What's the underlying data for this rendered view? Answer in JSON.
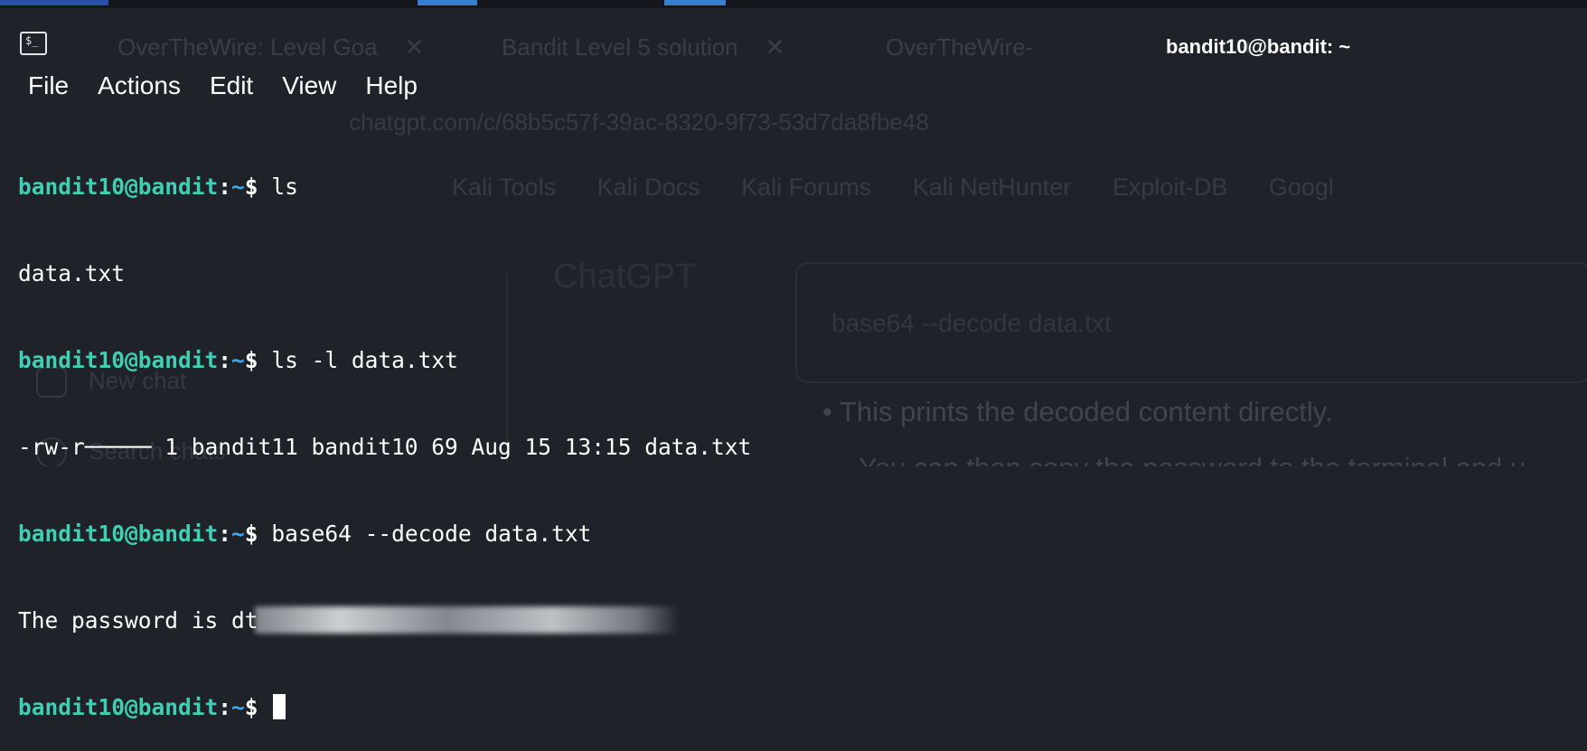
{
  "window": {
    "title": "bandit10@bandit: ~",
    "terminal_icon_glyph": "$_"
  },
  "menu": [
    "File",
    "Actions",
    "Edit",
    "View",
    "Help"
  ],
  "terminal": {
    "prompt_user": "bandit10@bandit",
    "prompt_colon": ":",
    "prompt_path": "~",
    "prompt_dollar": "$",
    "commands": [
      "ls",
      "ls -l data.txt",
      "base64 --decode data.txt"
    ],
    "outputs": [
      "data.txt",
      "-rw-r───── 1 bandit11 bandit10 69 Aug 15 13:15 data.txt",
      "The password is dt"
    ]
  },
  "background": {
    "tabs": [
      {
        "label": "OverTheWire: Level Goa",
        "close": "✕"
      },
      {
        "label": "Bandit Level 5 solution",
        "close": "✕"
      },
      {
        "label": "OverTheWire-",
        "close": "+"
      }
    ],
    "address": "chatgpt.com/c/68b5c57f-39ac-8320-9f73-53d7da8fbe48",
    "bookmarks": [
      "Kali Tools",
      "Kali Docs",
      "Kali Forums",
      "Kali NetHunter",
      "Exploit-DB",
      "Googl"
    ],
    "chat_title": "ChatGPT",
    "code_snippet": "base64 --decode data.txt",
    "sidebar": [
      "New chat",
      "Search chats"
    ],
    "bullets": [
      "•  This prints the decoded content directly.",
      "You can then copy the password to the terminal and u"
    ]
  },
  "colors": {
    "background": "#1f2228",
    "prompt_user": "#3ecfb4",
    "prompt_path": "#3ea8f5",
    "text": "#ffffff"
  }
}
